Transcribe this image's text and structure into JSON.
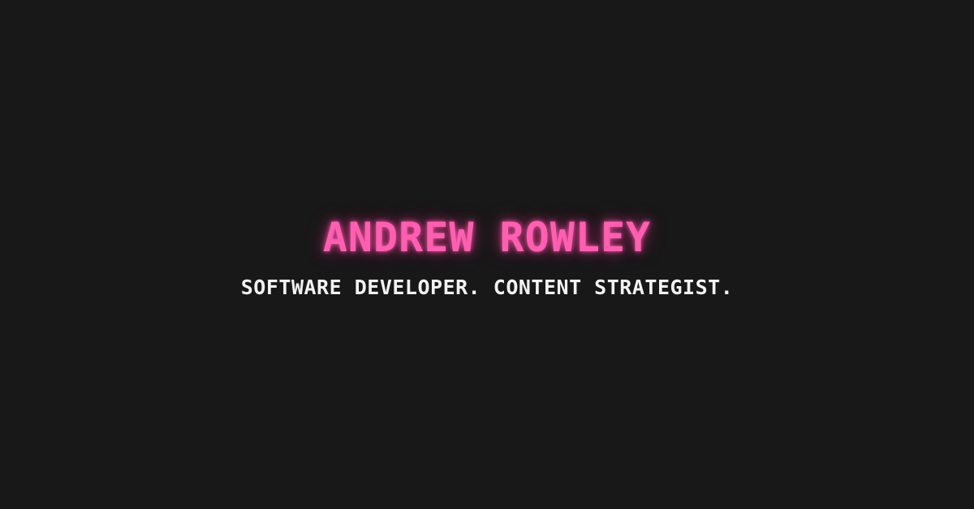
{
  "name": "ANDREW ROWLEY",
  "tagline": "SOFTWARE DEVELOPER. CONTENT STRATEGIST.",
  "colors": {
    "background": "#181818",
    "name": "#ff5fb0",
    "tagline": "#f2f2f2"
  }
}
